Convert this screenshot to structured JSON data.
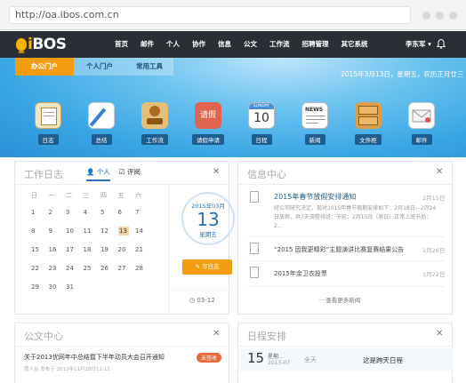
{
  "browser": {
    "url": "http://oa.ibos.com.cn"
  },
  "nav": {
    "logo_text": "iBOS",
    "items": [
      "首页",
      "邮件",
      "个人",
      "协作",
      "信息",
      "公文",
      "工作流",
      "招聘管理",
      "其它系统"
    ],
    "user": "李东军"
  },
  "banner": {
    "tabs": [
      "办公门户",
      "个人门户",
      "常用工具"
    ],
    "date": "2015年3月13日，星期五，农历正月廿三",
    "apps": [
      {
        "label": "日志",
        "icon": "journal-icon"
      },
      {
        "label": "总结",
        "icon": "pen-notebook-icon"
      },
      {
        "label": "工作流",
        "icon": "stamp-icon"
      },
      {
        "label": "请假申请",
        "icon": "leave-request-icon",
        "glyph": "请假"
      },
      {
        "label": "日程",
        "icon": "calendar-icon",
        "glyph": "10",
        "top": "SUNDAY"
      },
      {
        "label": "新闻",
        "icon": "newspaper-icon",
        "glyph": "NEWS"
      },
      {
        "label": "文件柜",
        "icon": "file-cabinet-icon"
      },
      {
        "label": "邮件",
        "icon": "mail-icon"
      }
    ]
  },
  "worklog": {
    "title": "工作日志",
    "tabs": [
      "个人",
      "评阅"
    ],
    "weekdays": [
      "日",
      "一",
      "二",
      "三",
      "四",
      "五",
      "六"
    ],
    "days": [
      "1",
      "2",
      "3",
      "4",
      "5",
      "6",
      "7",
      "8",
      "9",
      "10",
      "11",
      "12",
      "13",
      "14",
      "15",
      "16",
      "17",
      "18",
      "19",
      "20",
      "21",
      "22",
      "23",
      "24",
      "25",
      "26",
      "27",
      "28",
      "29",
      "30",
      "31"
    ],
    "today": {
      "month": "2015年03月",
      "day": "13",
      "weekday": "星期五"
    },
    "write_button": "写日志",
    "clock_date": "03-12"
  },
  "news": {
    "title": "信息中心",
    "featured": {
      "headline": "2015年春节放假安排通知",
      "date": "2月15日",
      "body": "经公司研究决定，现对2015年春节假期安排如下：2月18日—2月24日放假，共7天调整排班：节前：2月15日（周日）正常上班节后：2..."
    },
    "rows": [
      {
        "text": "“2015 因我更精彩”主题演讲比赛复赛结果公告",
        "date": "1月26日"
      },
      {
        "text": "2015年余卫衣投票",
        "date": "1月22日"
      }
    ],
    "more": "查看更多新闻"
  },
  "docs": {
    "title": "公文中心",
    "row": {
      "text": "关于2013优网年中总结暨下半年动员大会召开通知",
      "badge": "未签收",
      "meta": "愿人丛 发布于 2013年11月28日12:12"
    }
  },
  "schedule": {
    "title": "日程安排",
    "day": "15",
    "weekday": "星期...",
    "date": "2013-07",
    "allday": "全天",
    "event": "这是跨天日程"
  },
  "colors": {
    "accent_orange": "#f39c12",
    "brand_blue": "#2a6fbd",
    "nav_dark": "#2b2f35"
  }
}
